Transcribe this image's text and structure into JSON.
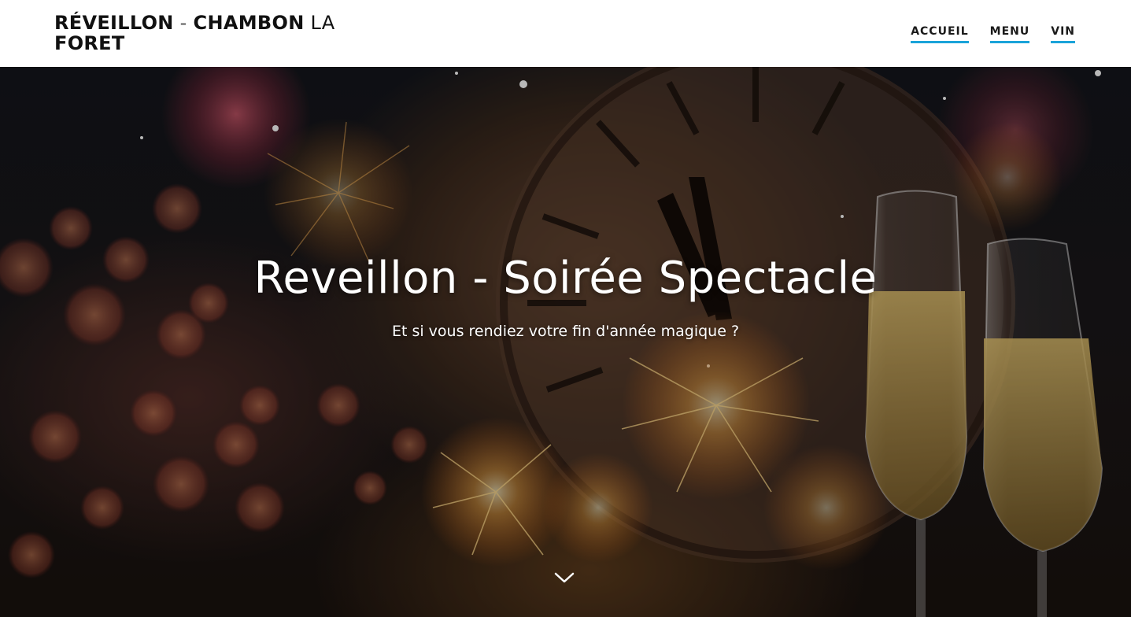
{
  "header": {
    "brand": {
      "part1": "RÉVEILLON",
      "separator": "-",
      "part2": "CHAMBON",
      "part3": "LA",
      "part4": "FORET"
    },
    "nav": [
      {
        "label": "ACCUEIL"
      },
      {
        "label": "MENU"
      },
      {
        "label": "VIN"
      }
    ]
  },
  "hero": {
    "title": "Reveillon - Soirée Spectacle",
    "subtitle": "Et si vous rendiez votre fin d'année magique ?",
    "scroll_icon": "chevron-down-icon"
  },
  "colors": {
    "accent": "#1aa3d9",
    "header_bg": "#ffffff",
    "hero_text": "#ffffff"
  }
}
